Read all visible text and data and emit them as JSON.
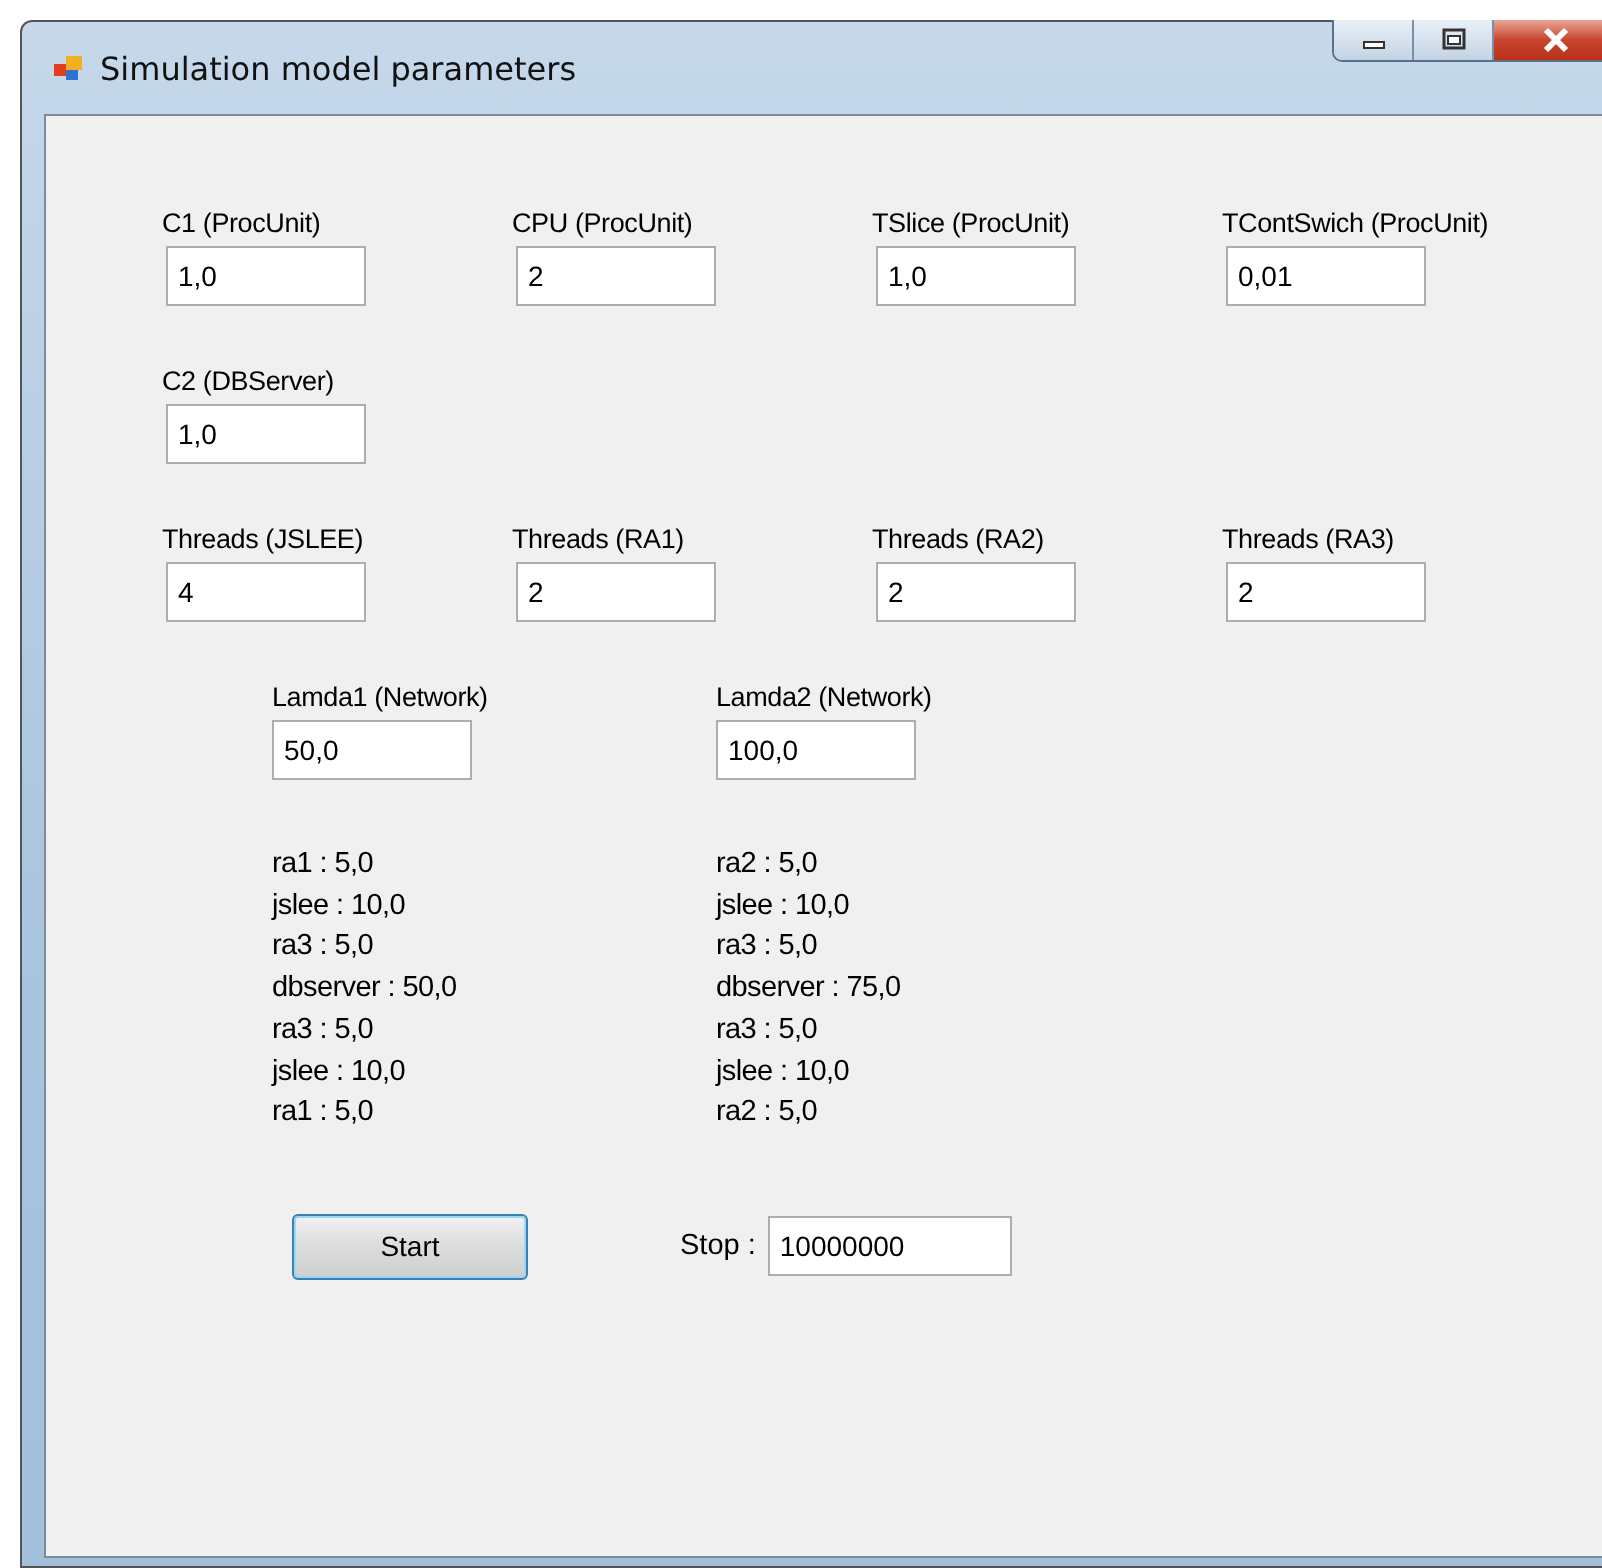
{
  "window": {
    "title": "Simulation model parameters"
  },
  "param_rows": [
    [
      {
        "label": "C1 (ProcUnit)",
        "value": "1,0"
      },
      {
        "label": "CPU (ProcUnit)",
        "value": "2"
      },
      {
        "label": "TSlice (ProcUnit)",
        "value": "1,0"
      },
      {
        "label": "TContSwich (ProcUnit)",
        "value": "0,01"
      }
    ],
    [
      {
        "label": "C2 (DBServer)",
        "value": "1,0"
      }
    ],
    [
      {
        "label": "Threads (JSLEE)",
        "value": "4"
      },
      {
        "label": "Threads (RA1)",
        "value": "2"
      },
      {
        "label": "Threads (RA2)",
        "value": "2"
      },
      {
        "label": "Threads (RA3)",
        "value": "2"
      }
    ]
  ],
  "networks": [
    {
      "label": "Lamda1 (Network)",
      "value": "50,0",
      "routes": [
        "ra1 : 5,0",
        "jslee : 10,0",
        "ra3 : 5,0",
        "dbserver : 50,0",
        "ra3 : 5,0",
        "jslee : 10,0",
        "ra1 : 5,0"
      ]
    },
    {
      "label": "Lamda2 (Network)",
      "value": "100,0",
      "routes": [
        "ra2 : 5,0",
        "jslee : 10,0",
        "ra3 : 5,0",
        "dbserver : 75,0",
        "ra3 : 5,0",
        "jslee : 10,0",
        "ra2 : 5,0"
      ]
    }
  ],
  "start_button": "Start",
  "stop": {
    "label": "Stop :",
    "value": "10000000"
  }
}
